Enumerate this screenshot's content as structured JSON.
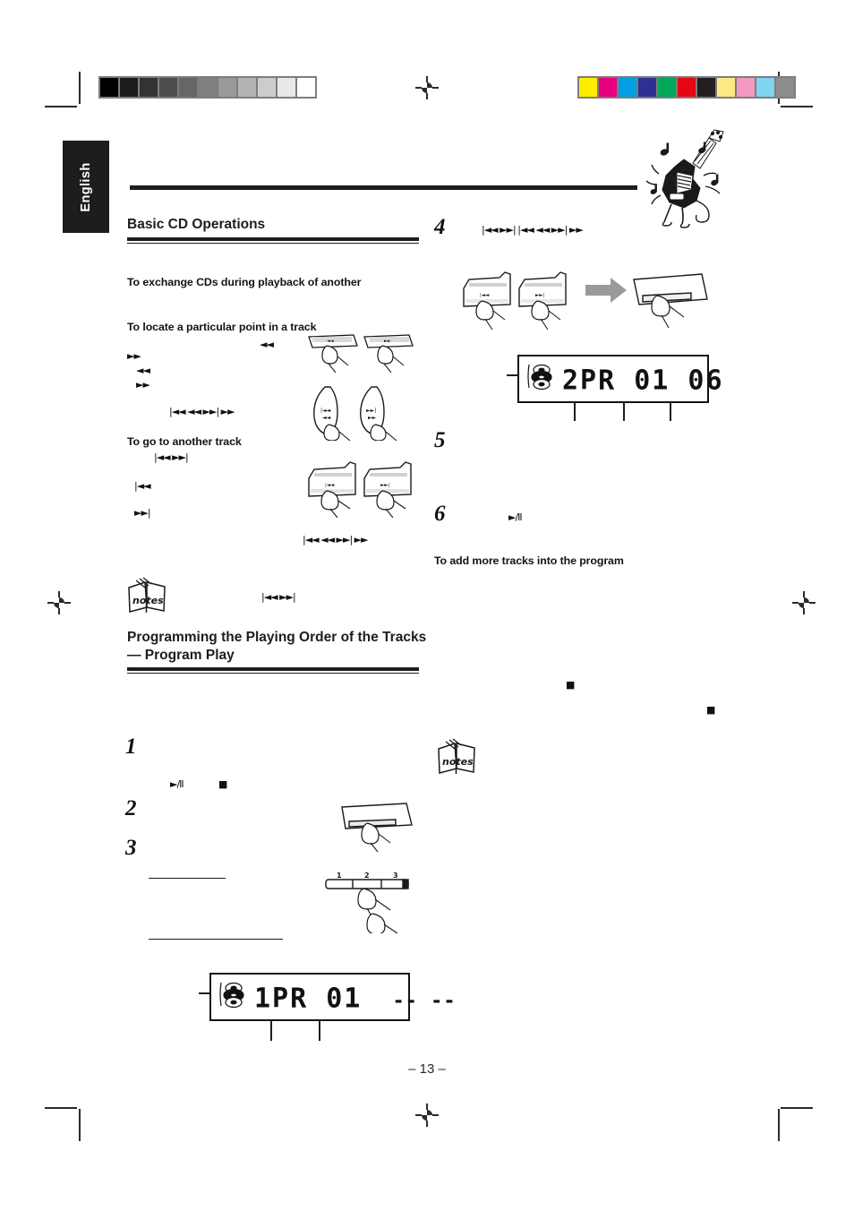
{
  "document": {
    "language_tab": "English",
    "page_number": "– 13 –"
  },
  "sections": {
    "basic_cd": {
      "title": "Basic CD Operations",
      "subheadings": [
        "To exchange CDs during playback of another",
        "To locate a particular point in a track",
        "To go to another track"
      ]
    },
    "program": {
      "title_line1": "Programming the Playing Order of the Tracks",
      "title_line2": "— Program Play",
      "steps": [
        "1",
        "2",
        "3",
        "4",
        "5",
        "6"
      ],
      "add_tracks_heading": "To add more tracks into the program"
    }
  },
  "glyphs": {
    "rew": "◄◄",
    "ff": "►►",
    "prev_track": "|◄◄",
    "next_track": "►►|",
    "play_pause": "►/II",
    "stop": "■",
    "notes_label": "notes"
  },
  "left_column_glyph_rows": {
    "row_rew_right": "◄◄",
    "row_ff": "►►",
    "row_rew": "◄◄",
    "row_ff2": "►►",
    "row_quad": "|◄◄   ◄◄      ►►|  ►►",
    "track_pair": "|◄◄     ►►|",
    "prev_single": "|◄◄",
    "next_single": "►►|",
    "quad_under_art": "|◄◄  ◄◄   ►►|  ►►",
    "notes_pair": "|◄◄  ►►|"
  },
  "right_column_glyph_rows": {
    "step4_row": "|◄◄    ►►| |◄◄  ◄◄    ►►|  ►►"
  },
  "displays": {
    "program_first": {
      "text": "1PR  01",
      "dashes": "-- --",
      "icon": "cd-changer-icon"
    },
    "program_second": {
      "text": "2PR  01  06",
      "dashes": "",
      "icon": "cd-changer-icon"
    }
  },
  "keypad": {
    "keys": [
      "1",
      "2",
      "3"
    ]
  },
  "calibration": {
    "gray_steps": [
      "#000000",
      "#1c1c1c",
      "#333333",
      "#4d4d4d",
      "#666666",
      "#808080",
      "#999999",
      "#b3b3b3",
      "#cccccc",
      "#e8e8e8",
      "#ffffff"
    ],
    "color_patches": [
      "#ffed00",
      "#e6007e",
      "#009fe3",
      "#2e3192",
      "#00a65a",
      "#e30613",
      "#231f20",
      "#fbe984",
      "#f49ac1",
      "#7fd4f2",
      "#8c8c8c"
    ]
  }
}
